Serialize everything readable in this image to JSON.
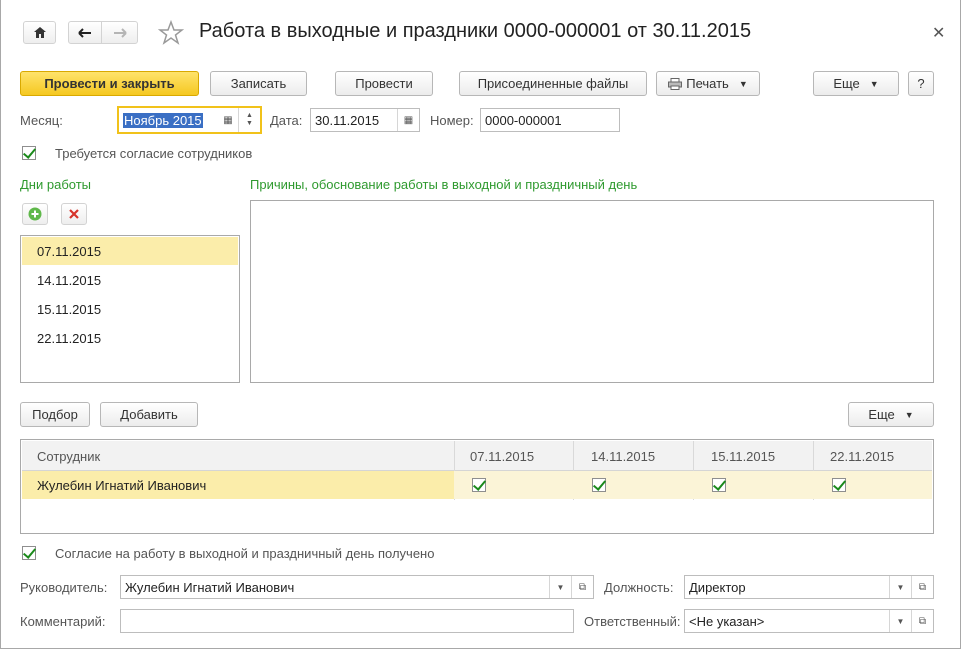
{
  "window": {
    "title": "Работа в выходные и праздники 0000-000001 от 30.11.2015"
  },
  "toolbar": {
    "post_close": "Провести и закрыть",
    "save": "Записать",
    "post": "Провести",
    "attached_files": "Присоединенные файлы",
    "print": "Печать",
    "more": "Еще",
    "help": "?"
  },
  "header_fields": {
    "month_label": "Месяц:",
    "month_value": "Ноябрь 2015",
    "date_label": "Дата:",
    "date_value": "30.11.2015",
    "number_label": "Номер:",
    "number_value": "0000-000001"
  },
  "consent_required": {
    "label": "Требуется согласие сотрудников",
    "checked": true
  },
  "work_days": {
    "label": "Дни работы",
    "items": [
      "07.11.2015",
      "14.11.2015",
      "15.11.2015",
      "22.11.2015"
    ],
    "selected_index": 0
  },
  "reasons": {
    "label": "Причины, обоснование работы в выходной и праздничный день",
    "value": ""
  },
  "employees_toolbar": {
    "pick": "Подбор",
    "add": "Добавить",
    "more": "Еще"
  },
  "employees_table": {
    "columns": [
      "Сотрудник",
      "07.11.2015",
      "14.11.2015",
      "15.11.2015",
      "22.11.2015"
    ],
    "rows": [
      {
        "employee": "Жулебин Игнатий Иванович",
        "days": [
          true,
          true,
          true,
          true
        ]
      }
    ]
  },
  "consent_received": {
    "label": "Согласие на работу в выходной и праздничный день получено",
    "checked": true
  },
  "footer": {
    "manager_label": "Руководитель:",
    "manager_value": "Жулебин Игнатий Иванович",
    "position_label": "Должность:",
    "position_value": "Директор",
    "comment_label": "Комментарий:",
    "comment_value": "",
    "responsible_label": "Ответственный:",
    "responsible_value": "<Не указан>"
  },
  "colors": {
    "accent_yellow": "#f5c821",
    "selection_blue": "#3a6fc4",
    "section_green": "#2f9a2f",
    "row_highlight": "#fbedaa"
  }
}
